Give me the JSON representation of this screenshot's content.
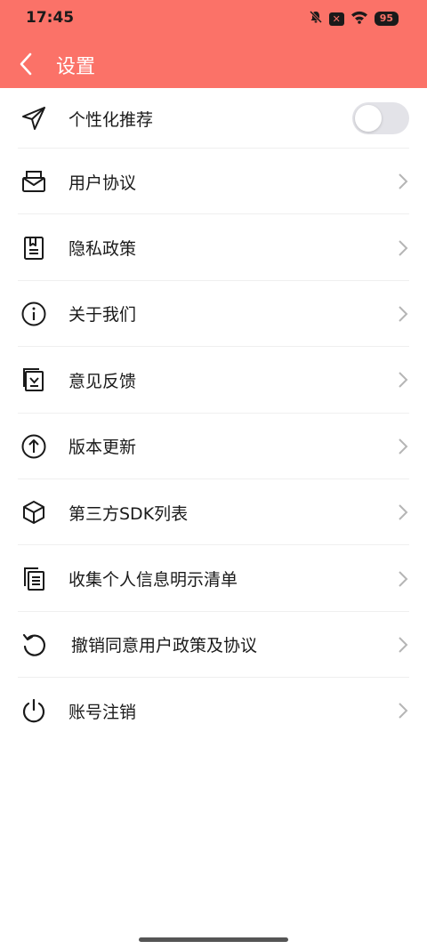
{
  "status_bar": {
    "time": "17:45",
    "battery": "95",
    "icons": [
      "bell-muted-icon",
      "x-badge-icon",
      "wifi-icon",
      "battery-icon"
    ]
  },
  "header": {
    "title": "设置",
    "background_color": "#fb7268"
  },
  "settings": {
    "items": [
      {
        "label": "个性化推荐",
        "icon": "send-icon",
        "control": "toggle",
        "toggle_on": false
      },
      {
        "label": "用户协议",
        "icon": "mail-tray-icon",
        "control": "chevron"
      },
      {
        "label": "隐私政策",
        "icon": "document-icon",
        "control": "chevron"
      },
      {
        "label": "关于我们",
        "icon": "info-icon",
        "control": "chevron"
      },
      {
        "label": "意见反馈",
        "icon": "feedback-icon",
        "control": "chevron"
      },
      {
        "label": "版本更新",
        "icon": "upload-circle-icon",
        "control": "chevron"
      },
      {
        "label": "第三方SDK列表",
        "icon": "cube-icon",
        "control": "chevron"
      },
      {
        "label": "收集个人信息明示清单",
        "icon": "copy-icon",
        "control": "chevron"
      },
      {
        "label": "撤销同意用户政策及协议",
        "icon": "undo-icon",
        "control": "chevron"
      },
      {
        "label": "账号注销",
        "icon": "power-icon",
        "control": "chevron"
      }
    ]
  }
}
